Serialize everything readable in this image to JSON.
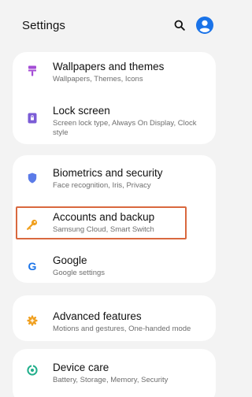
{
  "header": {
    "title": "Settings"
  },
  "colors": {
    "accent_blue": "#1a73e8",
    "wallpaper_icon": "#a44cd6",
    "lock_icon": "#7b5cd6",
    "biometrics_icon": "#5b7be8",
    "accounts_icon": "#f0a020",
    "advanced_icon": "#f0a020",
    "device_care_icon": "#1fae8a",
    "highlight_border": "#d9683e"
  },
  "items": [
    {
      "title": "Wallpapers and themes",
      "subtitle": "Wallpapers, Themes, Icons",
      "icon": "paint-roller-icon"
    },
    {
      "title": "Lock screen",
      "subtitle": "Screen lock type, Always On Display, Clock style",
      "icon": "lock-icon"
    },
    {
      "title": "Biometrics and security",
      "subtitle": "Face recognition, Iris, Privacy",
      "icon": "shield-icon"
    },
    {
      "title": "Accounts and backup",
      "subtitle": "Samsung Cloud, Smart Switch",
      "icon": "key-icon"
    },
    {
      "title": "Google",
      "subtitle": "Google settings",
      "icon": "google-icon"
    },
    {
      "title": "Advanced features",
      "subtitle": "Motions and gestures, One-handed mode",
      "icon": "gear-plus-icon"
    },
    {
      "title": "Device care",
      "subtitle": "Battery, Storage, Memory, Security",
      "icon": "device-care-icon"
    }
  ]
}
